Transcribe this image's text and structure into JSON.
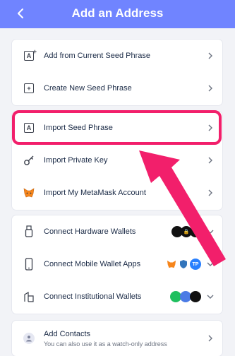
{
  "header": {
    "title": "Add an Address"
  },
  "cards": {
    "seed": {
      "items": [
        {
          "label": "Add from Current Seed Phrase"
        },
        {
          "label": "Create New Seed Phrase"
        }
      ]
    },
    "import": {
      "items": [
        {
          "label": "Import Seed Phrase"
        },
        {
          "label": "Import Private Key"
        },
        {
          "label": "Import My MetaMask Account"
        }
      ]
    },
    "connect": {
      "items": [
        {
          "label": "Connect Hardware Wallets"
        },
        {
          "label": "Connect Mobile Wallet Apps",
          "badge": "TP"
        },
        {
          "label": "Connect Institutional Wallets"
        }
      ]
    },
    "contacts": {
      "label": "Add Contacts",
      "sublabel": "You can also use it as a watch-only address"
    }
  },
  "colors": {
    "header": "#7084ff",
    "highlight": "#f21f6b",
    "arrow": "#f21f6b"
  }
}
